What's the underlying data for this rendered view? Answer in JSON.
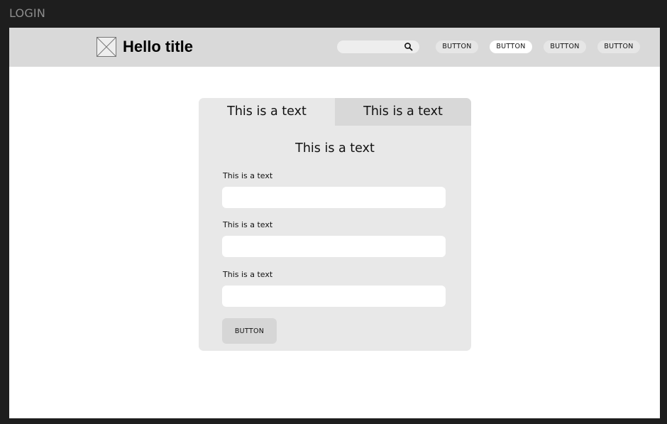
{
  "frame": {
    "label": "LOGIN"
  },
  "header": {
    "logo_icon": "image-placeholder-icon",
    "title": "Hello title",
    "search": {
      "icon": "search-icon",
      "value": "",
      "placeholder": ""
    },
    "nav_buttons": [
      {
        "label": "BUTTON",
        "style": "gray"
      },
      {
        "label": "BUTTON",
        "style": "white"
      },
      {
        "label": "BUTTON",
        "style": "gray"
      },
      {
        "label": "BUTTON",
        "style": "gray"
      }
    ]
  },
  "login_card": {
    "tabs": [
      {
        "label": "This is a text",
        "active": true
      },
      {
        "label": "This is a text",
        "active": false
      }
    ],
    "form_title": "This is a text",
    "fields": [
      {
        "label": "This is a text",
        "value": ""
      },
      {
        "label": "This is a text",
        "value": ""
      },
      {
        "label": "This is a text",
        "value": ""
      }
    ],
    "submit_label": "BUTTON"
  },
  "colors": {
    "outer_background": "#1e1e1e",
    "header_background": "#d9d9d9",
    "card_background": "#e8e8e8",
    "inactive_tab_background": "#d8d8d8",
    "nav_button_gray": "#e6e6e6",
    "nav_button_white": "#ffffff"
  }
}
